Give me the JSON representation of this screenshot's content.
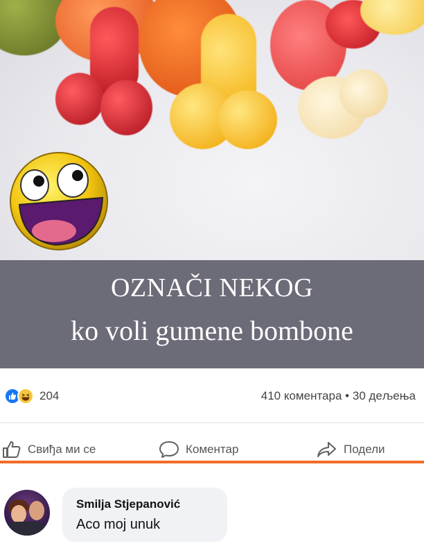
{
  "post": {
    "banner_line1": "OZNAČI NEKOG",
    "banner_line2": "ko voli gumene bombone"
  },
  "stats": {
    "reaction_count": "204",
    "comments": "410 коментара",
    "separator": "•",
    "shares": "30 дељења",
    "reactions": [
      "like-icon",
      "haha-icon"
    ]
  },
  "actions": {
    "like_label": "Свиђа ми се",
    "comment_label": "Коментар",
    "share_label": "Подели"
  },
  "comment": {
    "author": "Smilja Stjepanović",
    "text": "Aco moj unuk"
  },
  "colors": {
    "banner": "#6c6b78",
    "accent_line": "#f06c28",
    "like_blue": "#1877f2",
    "bubble": "#f0f2f5"
  }
}
